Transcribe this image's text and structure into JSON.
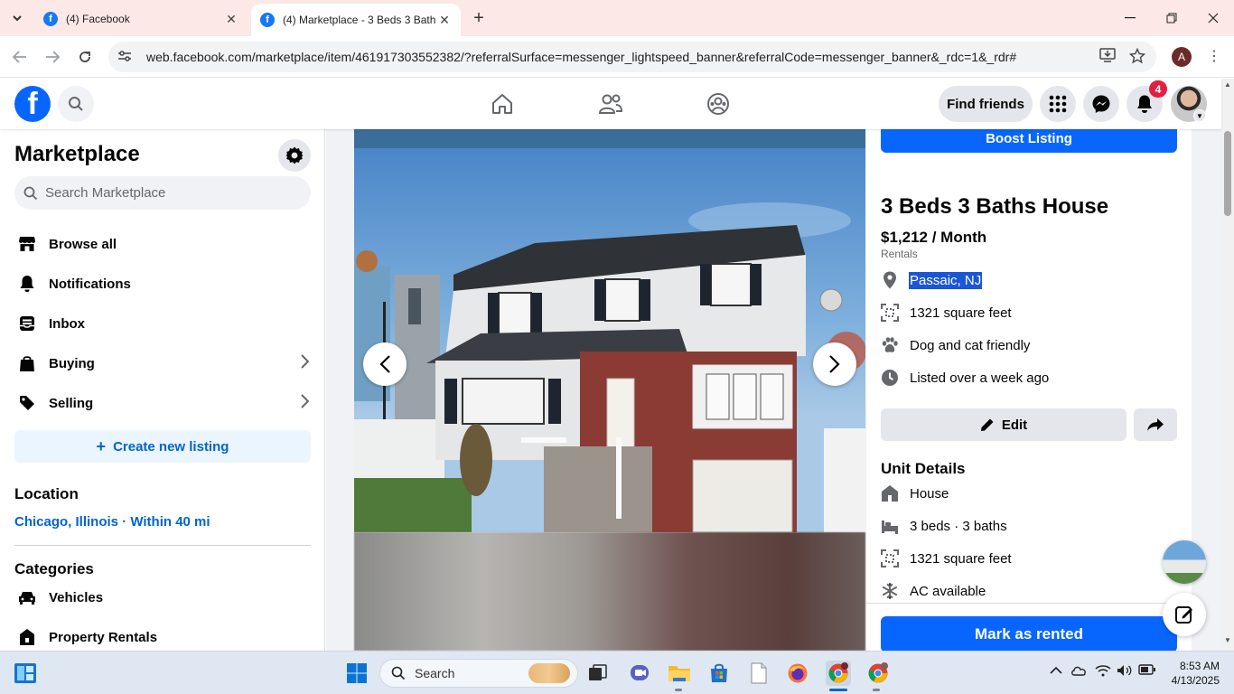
{
  "browser": {
    "tabs": [
      {
        "title": "(4) Facebook",
        "active": false
      },
      {
        "title": "(4) Marketplace - 3 Beds 3 Bath",
        "active": true
      }
    ],
    "url": "web.facebook.com/marketplace/item/461917303552382/?referralSurface=messenger_lightspeed_banner&referralCode=messenger_banner&_rdc=1&_rdr#",
    "profile_initial": "A"
  },
  "fb_header": {
    "find_friends_label": "Find friends",
    "notification_count": "4",
    "brand_color": "#0866ff"
  },
  "sidebar": {
    "title": "Marketplace",
    "search_placeholder": "Search Marketplace",
    "items": [
      {
        "label": "Browse all",
        "icon": "storefront-icon"
      },
      {
        "label": "Notifications",
        "icon": "bell-icon"
      },
      {
        "label": "Inbox",
        "icon": "inbox-icon"
      },
      {
        "label": "Buying",
        "icon": "shopping-bag-icon"
      },
      {
        "label": "Selling",
        "icon": "tag-icon"
      }
    ],
    "create_listing_label": "Create new listing",
    "location_heading": "Location",
    "location_value": "Chicago, Illinois · Within 40 mi",
    "categories_heading": "Categories",
    "categories": [
      {
        "label": "Vehicles",
        "icon": "car-icon"
      },
      {
        "label": "Property Rentals",
        "icon": "house-key-icon"
      }
    ]
  },
  "listing": {
    "boost_label": "Boost Listing",
    "title": "3 Beds 3 Baths House",
    "price": "$1,212 / Month",
    "category": "Rentals",
    "location": "Passaic, NJ",
    "square_feet": "1321 square feet",
    "pets": "Dog and cat friendly",
    "listed": "Listed over a week ago",
    "edit_label": "Edit",
    "unit_details_heading": "Unit Details",
    "unit_details": [
      {
        "label": "House",
        "icon": "house-icon"
      },
      {
        "label": "3 beds · 3 baths",
        "icon": "bed-icon"
      },
      {
        "label": "1321 square feet",
        "icon": "area-icon"
      },
      {
        "label": "AC available",
        "icon": "snowflake-icon"
      }
    ],
    "mark_rented_label": "Mark as rented"
  },
  "taskbar": {
    "search_label": "Search",
    "time": "8:53 AM",
    "date": "4/13/2025"
  }
}
